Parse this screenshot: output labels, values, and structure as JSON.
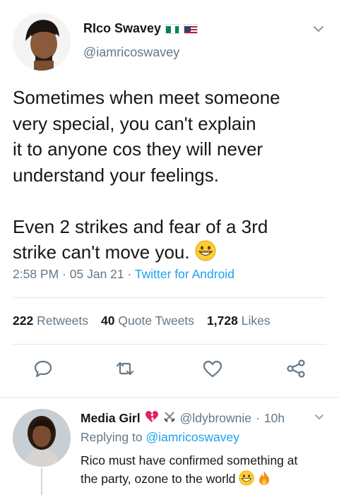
{
  "tweet": {
    "author_name": "RIco Swavey",
    "author_handle": "@iamricoswavey",
    "text": "Sometimes when meet someone\nvery special,  you can't explain\nit to anyone cos they will never\nunderstand your feelings.\n\nEven 2 strikes and fear of a 3rd\nstrike can't move you.",
    "time": "2:58 PM",
    "date": "05 Jan 21",
    "source": "Twitter for Android",
    "emoji_icon": "grinning-face-icon"
  },
  "stats": {
    "retweets_count": "222",
    "retweets_label": "Retweets",
    "quotes_count": "40",
    "quotes_label": "Quote Tweets",
    "likes_count": "1,728",
    "likes_label": "Likes"
  },
  "actions": [
    "reply-icon",
    "retweet-icon",
    "like-icon",
    "share-icon"
  ],
  "reply": {
    "author_name": "Media Girl",
    "author_handle": "@ldybrownie",
    "age": "10h",
    "replying_prefix": "Replying to",
    "replying_to": "@iamricoswavey",
    "text_line1": "Rico must have confirmed something at",
    "text_line2": "the party, ozone to the world"
  },
  "colors": {
    "accent": "#1da1f2",
    "secondary_text": "#657786",
    "divider": "#e1e8ed"
  }
}
